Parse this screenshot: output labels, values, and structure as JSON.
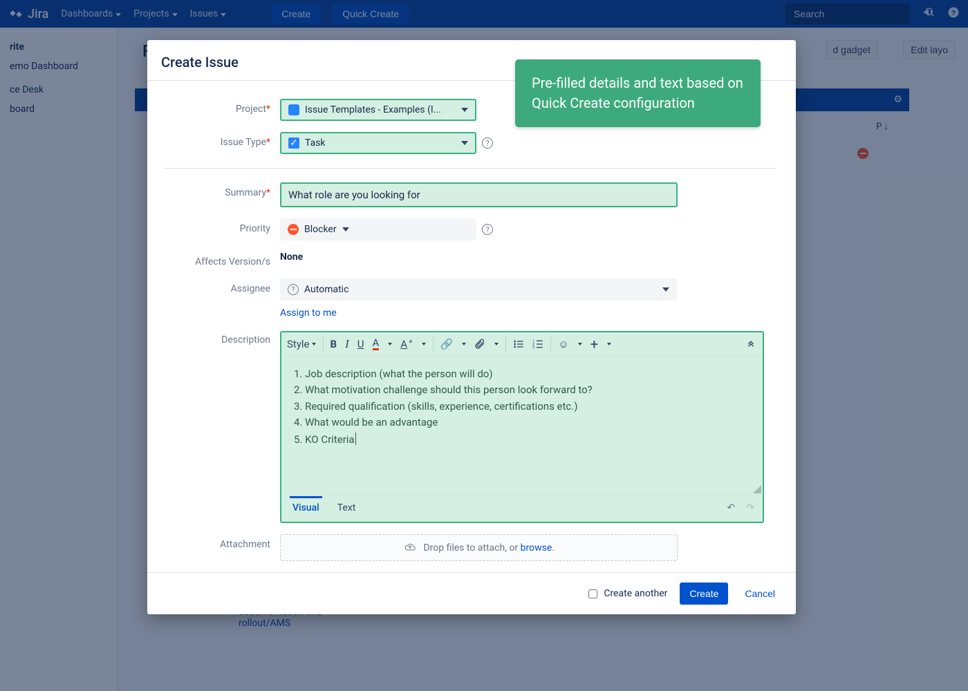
{
  "header": {
    "product": "Jira",
    "nav": [
      "Dashboards",
      "Projects",
      "Issues"
    ],
    "create": "Create",
    "quick_create": "Quick Create",
    "search_placeholder": "Search"
  },
  "sidebar": {
    "items": [
      "rite",
      "emo Dashboard",
      "ce Desk",
      "board"
    ]
  },
  "bg": {
    "page_title": "Fa",
    "add_gadget": "d gadget",
    "edit_layout": "Edit layo",
    "row_sort": "P ↓",
    "row_link": "documentation and rollout/AMS"
  },
  "callout": "Pre-filled details and text based on Quick Create configuration",
  "dialog": {
    "title": "Create Issue",
    "labels": {
      "project": "Project",
      "issue_type": "Issue Type",
      "summary": "Summary",
      "priority": "Priority",
      "affects": "Affects Version/s",
      "assignee": "Assignee",
      "description": "Description",
      "attachment": "Attachment"
    },
    "fields": {
      "project": "Issue Templates - Examples (I...",
      "issue_type": "Task",
      "summary": "What role are you looking for",
      "priority": "Blocker",
      "affects": "None",
      "assignee": "Automatic",
      "assign_to_me": "Assign to me",
      "description_items": [
        "Job description (what the person will do)",
        "What motivation challenge should this person look forward to?",
        "Required qualification (skills, experience, certifications etc.)",
        "What would be an advantage",
        "KO Criteria"
      ]
    },
    "rte": {
      "style": "Style",
      "tabs": {
        "visual": "Visual",
        "text": "Text"
      }
    },
    "attachment_hint_pre": "Drop files to attach, or ",
    "attachment_hint_link": "browse",
    "footer": {
      "create_another": "Create another",
      "create": "Create",
      "cancel": "Cancel"
    }
  }
}
